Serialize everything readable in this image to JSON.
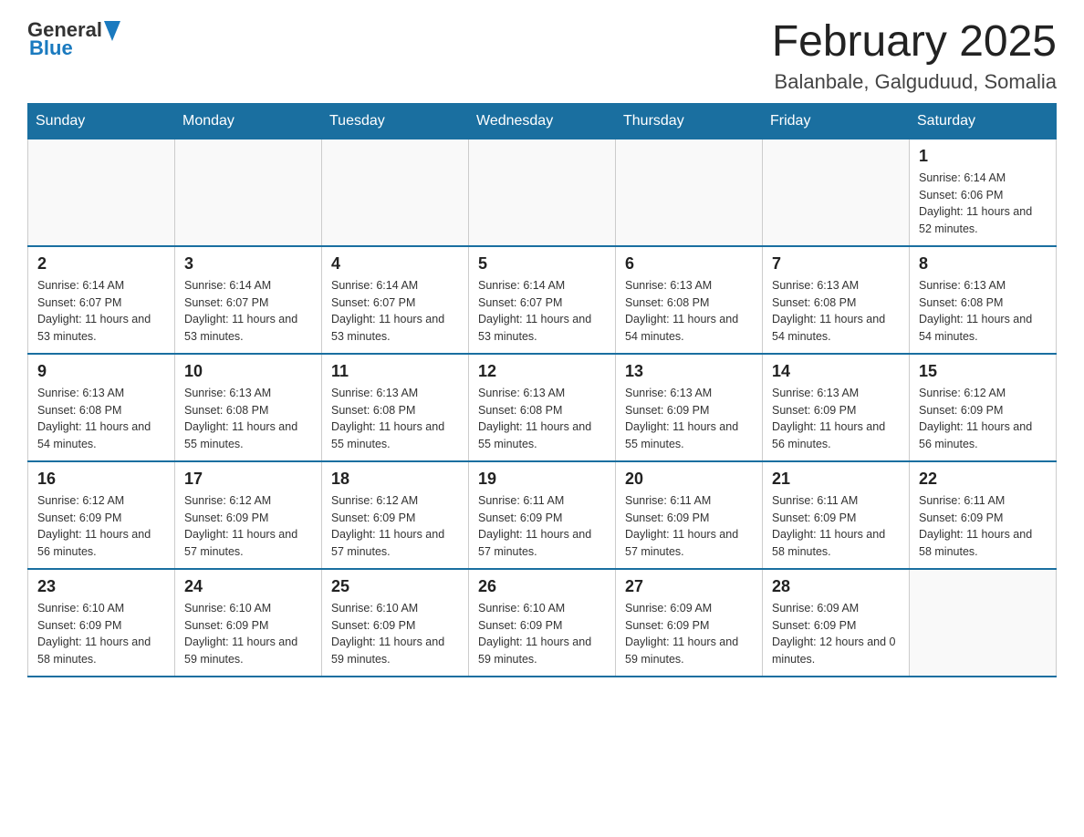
{
  "logo": {
    "text_general": "General",
    "text_blue": "Blue"
  },
  "header": {
    "month_title": "February 2025",
    "location": "Balanbale, Galguduud, Somalia"
  },
  "days_of_week": [
    "Sunday",
    "Monday",
    "Tuesday",
    "Wednesday",
    "Thursday",
    "Friday",
    "Saturday"
  ],
  "weeks": [
    [
      {
        "day": "",
        "sunrise": "",
        "sunset": "",
        "daylight": ""
      },
      {
        "day": "",
        "sunrise": "",
        "sunset": "",
        "daylight": ""
      },
      {
        "day": "",
        "sunrise": "",
        "sunset": "",
        "daylight": ""
      },
      {
        "day": "",
        "sunrise": "",
        "sunset": "",
        "daylight": ""
      },
      {
        "day": "",
        "sunrise": "",
        "sunset": "",
        "daylight": ""
      },
      {
        "day": "",
        "sunrise": "",
        "sunset": "",
        "daylight": ""
      },
      {
        "day": "1",
        "sunrise": "Sunrise: 6:14 AM",
        "sunset": "Sunset: 6:06 PM",
        "daylight": "Daylight: 11 hours and 52 minutes."
      }
    ],
    [
      {
        "day": "2",
        "sunrise": "Sunrise: 6:14 AM",
        "sunset": "Sunset: 6:07 PM",
        "daylight": "Daylight: 11 hours and 53 minutes."
      },
      {
        "day": "3",
        "sunrise": "Sunrise: 6:14 AM",
        "sunset": "Sunset: 6:07 PM",
        "daylight": "Daylight: 11 hours and 53 minutes."
      },
      {
        "day": "4",
        "sunrise": "Sunrise: 6:14 AM",
        "sunset": "Sunset: 6:07 PM",
        "daylight": "Daylight: 11 hours and 53 minutes."
      },
      {
        "day": "5",
        "sunrise": "Sunrise: 6:14 AM",
        "sunset": "Sunset: 6:07 PM",
        "daylight": "Daylight: 11 hours and 53 minutes."
      },
      {
        "day": "6",
        "sunrise": "Sunrise: 6:13 AM",
        "sunset": "Sunset: 6:08 PM",
        "daylight": "Daylight: 11 hours and 54 minutes."
      },
      {
        "day": "7",
        "sunrise": "Sunrise: 6:13 AM",
        "sunset": "Sunset: 6:08 PM",
        "daylight": "Daylight: 11 hours and 54 minutes."
      },
      {
        "day": "8",
        "sunrise": "Sunrise: 6:13 AM",
        "sunset": "Sunset: 6:08 PM",
        "daylight": "Daylight: 11 hours and 54 minutes."
      }
    ],
    [
      {
        "day": "9",
        "sunrise": "Sunrise: 6:13 AM",
        "sunset": "Sunset: 6:08 PM",
        "daylight": "Daylight: 11 hours and 54 minutes."
      },
      {
        "day": "10",
        "sunrise": "Sunrise: 6:13 AM",
        "sunset": "Sunset: 6:08 PM",
        "daylight": "Daylight: 11 hours and 55 minutes."
      },
      {
        "day": "11",
        "sunrise": "Sunrise: 6:13 AM",
        "sunset": "Sunset: 6:08 PM",
        "daylight": "Daylight: 11 hours and 55 minutes."
      },
      {
        "day": "12",
        "sunrise": "Sunrise: 6:13 AM",
        "sunset": "Sunset: 6:08 PM",
        "daylight": "Daylight: 11 hours and 55 minutes."
      },
      {
        "day": "13",
        "sunrise": "Sunrise: 6:13 AM",
        "sunset": "Sunset: 6:09 PM",
        "daylight": "Daylight: 11 hours and 55 minutes."
      },
      {
        "day": "14",
        "sunrise": "Sunrise: 6:13 AM",
        "sunset": "Sunset: 6:09 PM",
        "daylight": "Daylight: 11 hours and 56 minutes."
      },
      {
        "day": "15",
        "sunrise": "Sunrise: 6:12 AM",
        "sunset": "Sunset: 6:09 PM",
        "daylight": "Daylight: 11 hours and 56 minutes."
      }
    ],
    [
      {
        "day": "16",
        "sunrise": "Sunrise: 6:12 AM",
        "sunset": "Sunset: 6:09 PM",
        "daylight": "Daylight: 11 hours and 56 minutes."
      },
      {
        "day": "17",
        "sunrise": "Sunrise: 6:12 AM",
        "sunset": "Sunset: 6:09 PM",
        "daylight": "Daylight: 11 hours and 57 minutes."
      },
      {
        "day": "18",
        "sunrise": "Sunrise: 6:12 AM",
        "sunset": "Sunset: 6:09 PM",
        "daylight": "Daylight: 11 hours and 57 minutes."
      },
      {
        "day": "19",
        "sunrise": "Sunrise: 6:11 AM",
        "sunset": "Sunset: 6:09 PM",
        "daylight": "Daylight: 11 hours and 57 minutes."
      },
      {
        "day": "20",
        "sunrise": "Sunrise: 6:11 AM",
        "sunset": "Sunset: 6:09 PM",
        "daylight": "Daylight: 11 hours and 57 minutes."
      },
      {
        "day": "21",
        "sunrise": "Sunrise: 6:11 AM",
        "sunset": "Sunset: 6:09 PM",
        "daylight": "Daylight: 11 hours and 58 minutes."
      },
      {
        "day": "22",
        "sunrise": "Sunrise: 6:11 AM",
        "sunset": "Sunset: 6:09 PM",
        "daylight": "Daylight: 11 hours and 58 minutes."
      }
    ],
    [
      {
        "day": "23",
        "sunrise": "Sunrise: 6:10 AM",
        "sunset": "Sunset: 6:09 PM",
        "daylight": "Daylight: 11 hours and 58 minutes."
      },
      {
        "day": "24",
        "sunrise": "Sunrise: 6:10 AM",
        "sunset": "Sunset: 6:09 PM",
        "daylight": "Daylight: 11 hours and 59 minutes."
      },
      {
        "day": "25",
        "sunrise": "Sunrise: 6:10 AM",
        "sunset": "Sunset: 6:09 PM",
        "daylight": "Daylight: 11 hours and 59 minutes."
      },
      {
        "day": "26",
        "sunrise": "Sunrise: 6:10 AM",
        "sunset": "Sunset: 6:09 PM",
        "daylight": "Daylight: 11 hours and 59 minutes."
      },
      {
        "day": "27",
        "sunrise": "Sunrise: 6:09 AM",
        "sunset": "Sunset: 6:09 PM",
        "daylight": "Daylight: 11 hours and 59 minutes."
      },
      {
        "day": "28",
        "sunrise": "Sunrise: 6:09 AM",
        "sunset": "Sunset: 6:09 PM",
        "daylight": "Daylight: 12 hours and 0 minutes."
      },
      {
        "day": "",
        "sunrise": "",
        "sunset": "",
        "daylight": ""
      }
    ]
  ]
}
